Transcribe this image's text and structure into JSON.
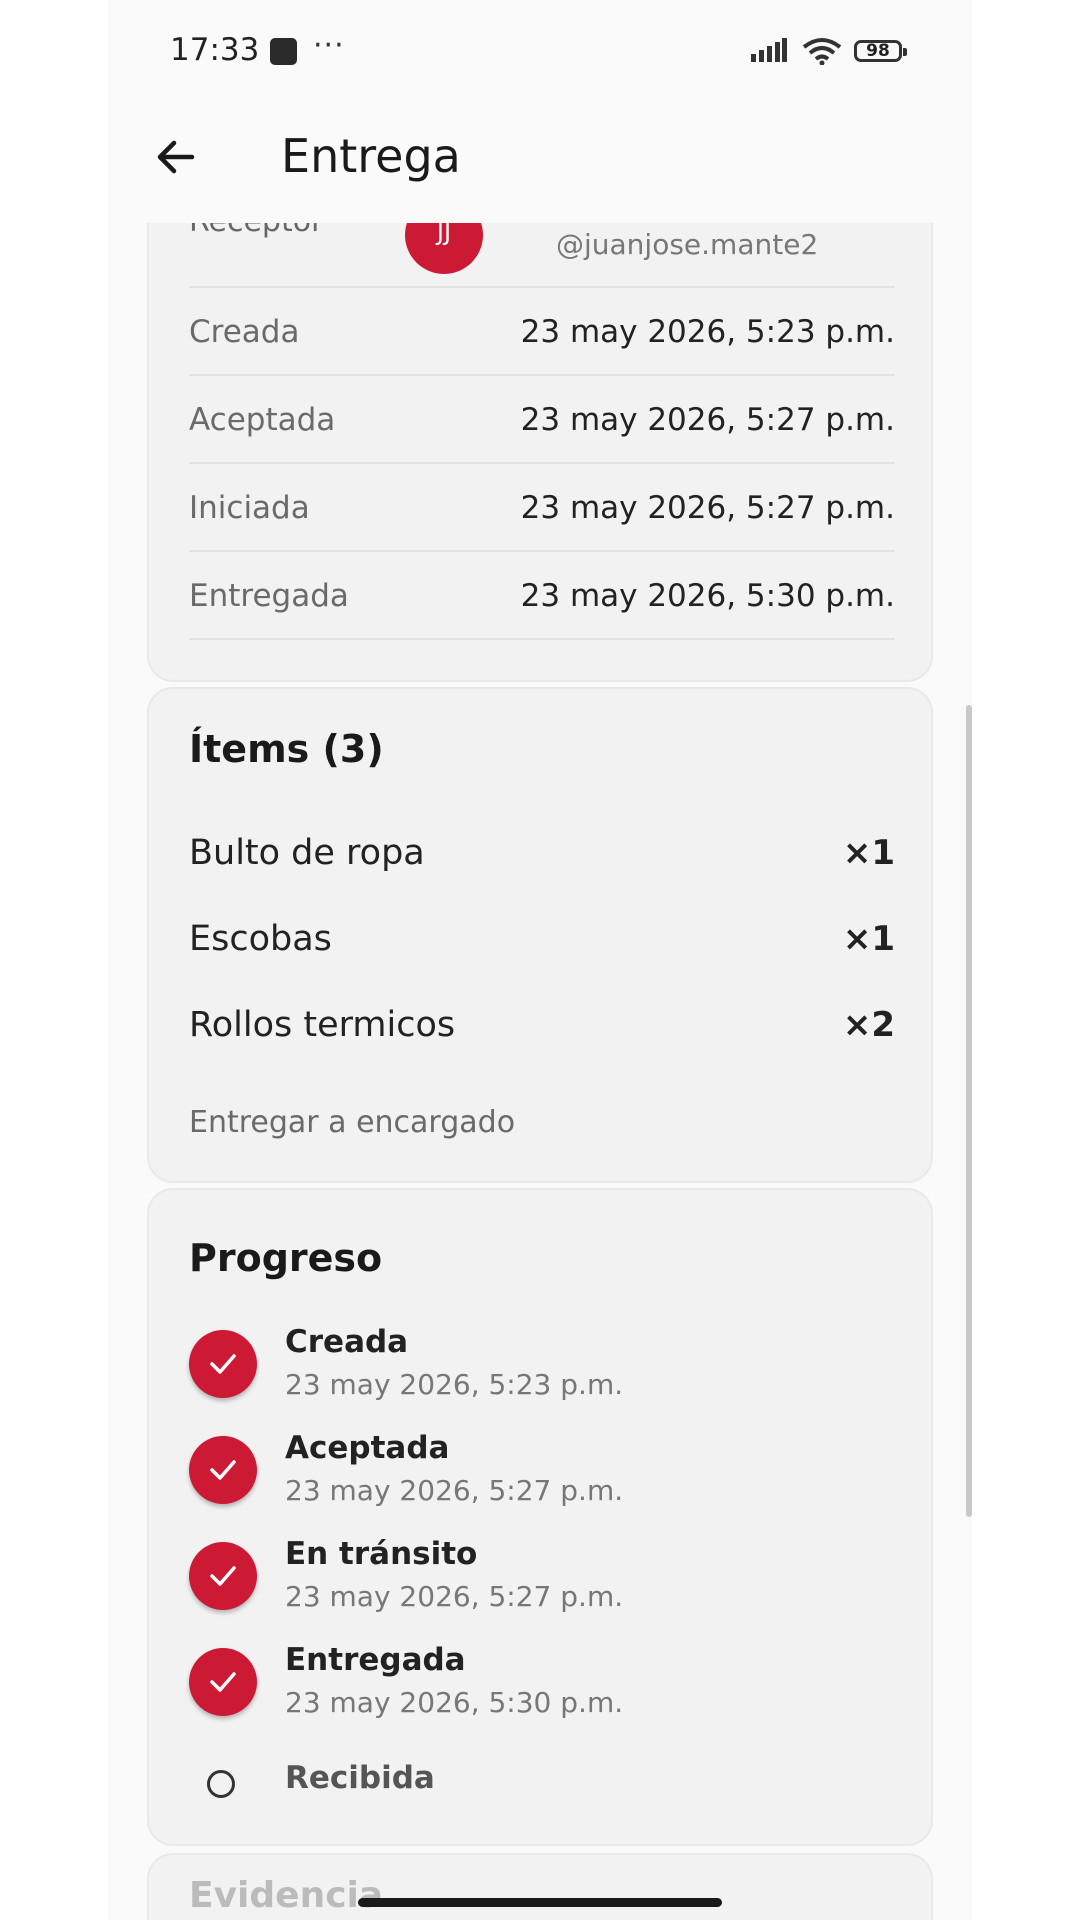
{
  "status_bar": {
    "time": "17:33",
    "dots": "···",
    "battery": "98"
  },
  "app_bar": {
    "title": "Entrega"
  },
  "details": {
    "receptor_label": "Receptor",
    "avatar_initials": "JJ",
    "username": "@juanjose.mante2",
    "rows": [
      {
        "label": "Creada",
        "value": "23 may 2026, 5:23 p.m."
      },
      {
        "label": "Aceptada",
        "value": "23 may 2026, 5:27 p.m."
      },
      {
        "label": "Iniciada",
        "value": "23 may 2026, 5:27 p.m."
      },
      {
        "label": "Entregada",
        "value": "23 may 2026, 5:30 p.m."
      }
    ]
  },
  "items": {
    "title": "Ítems (3)",
    "list": [
      {
        "name": "Bulto de ropa",
        "qty": "×1"
      },
      {
        "name": "Escobas",
        "qty": "×1"
      },
      {
        "name": "Rollos termicos",
        "qty": "×2"
      }
    ],
    "note": "Entregar a encargado"
  },
  "progress": {
    "title": "Progreso",
    "steps": [
      {
        "title": "Creada",
        "time": "23 may 2026, 5:23 p.m.",
        "done": true
      },
      {
        "title": "Aceptada",
        "time": "23 may 2026, 5:27 p.m.",
        "done": true
      },
      {
        "title": "En tránsito",
        "time": "23 may 2026, 5:27 p.m.",
        "done": true
      },
      {
        "title": "Entregada",
        "time": "23 may 2026, 5:30 p.m.",
        "done": true
      },
      {
        "title": "Recibida",
        "done": false
      }
    ]
  },
  "evidence": {
    "title": "Evidencia"
  },
  "colors": {
    "accent": "#cc1a34",
    "card": "#f2f2f2",
    "background": "#fafafa"
  }
}
